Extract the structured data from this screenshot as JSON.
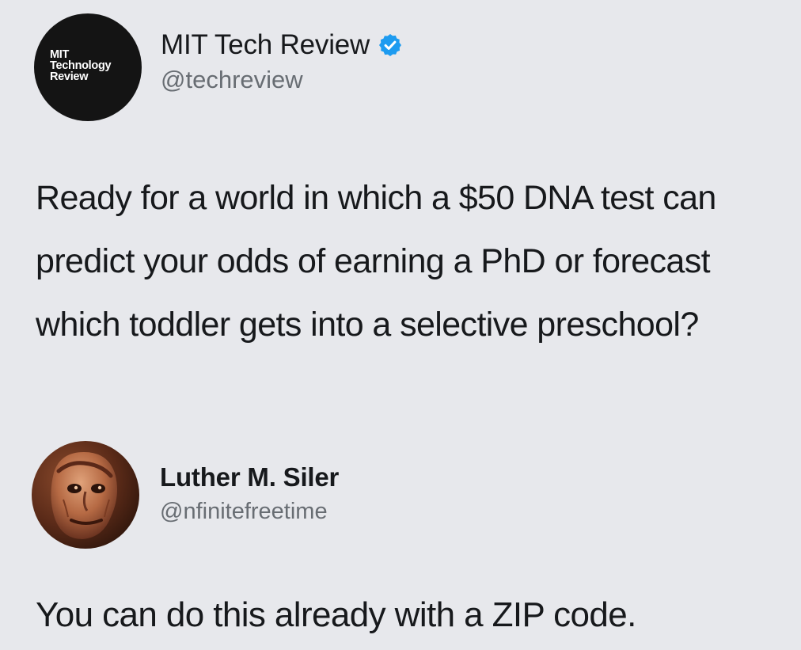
{
  "tweet": {
    "logo_text": "MIT Technology Review",
    "display_name": "MIT Tech Review",
    "verified_icon": "verified-check-icon",
    "handle": "@techreview",
    "text": "Ready for a world in which a $50 DNA test can predict your odds of earning a PhD or forecast which toddler gets into a selective preschool?"
  },
  "reply": {
    "avatar_icon": "profile-portrait",
    "display_name": "Luther M. Siler",
    "handle": "@nfinitefreetime",
    "text": "You can do this already with a ZIP code."
  },
  "colors": {
    "background": "#e7e8ec",
    "text": "#17191c",
    "secondary_text": "#686d73",
    "verified_blue": "#1d9bf0",
    "mit_logo_bg": "#141414"
  }
}
